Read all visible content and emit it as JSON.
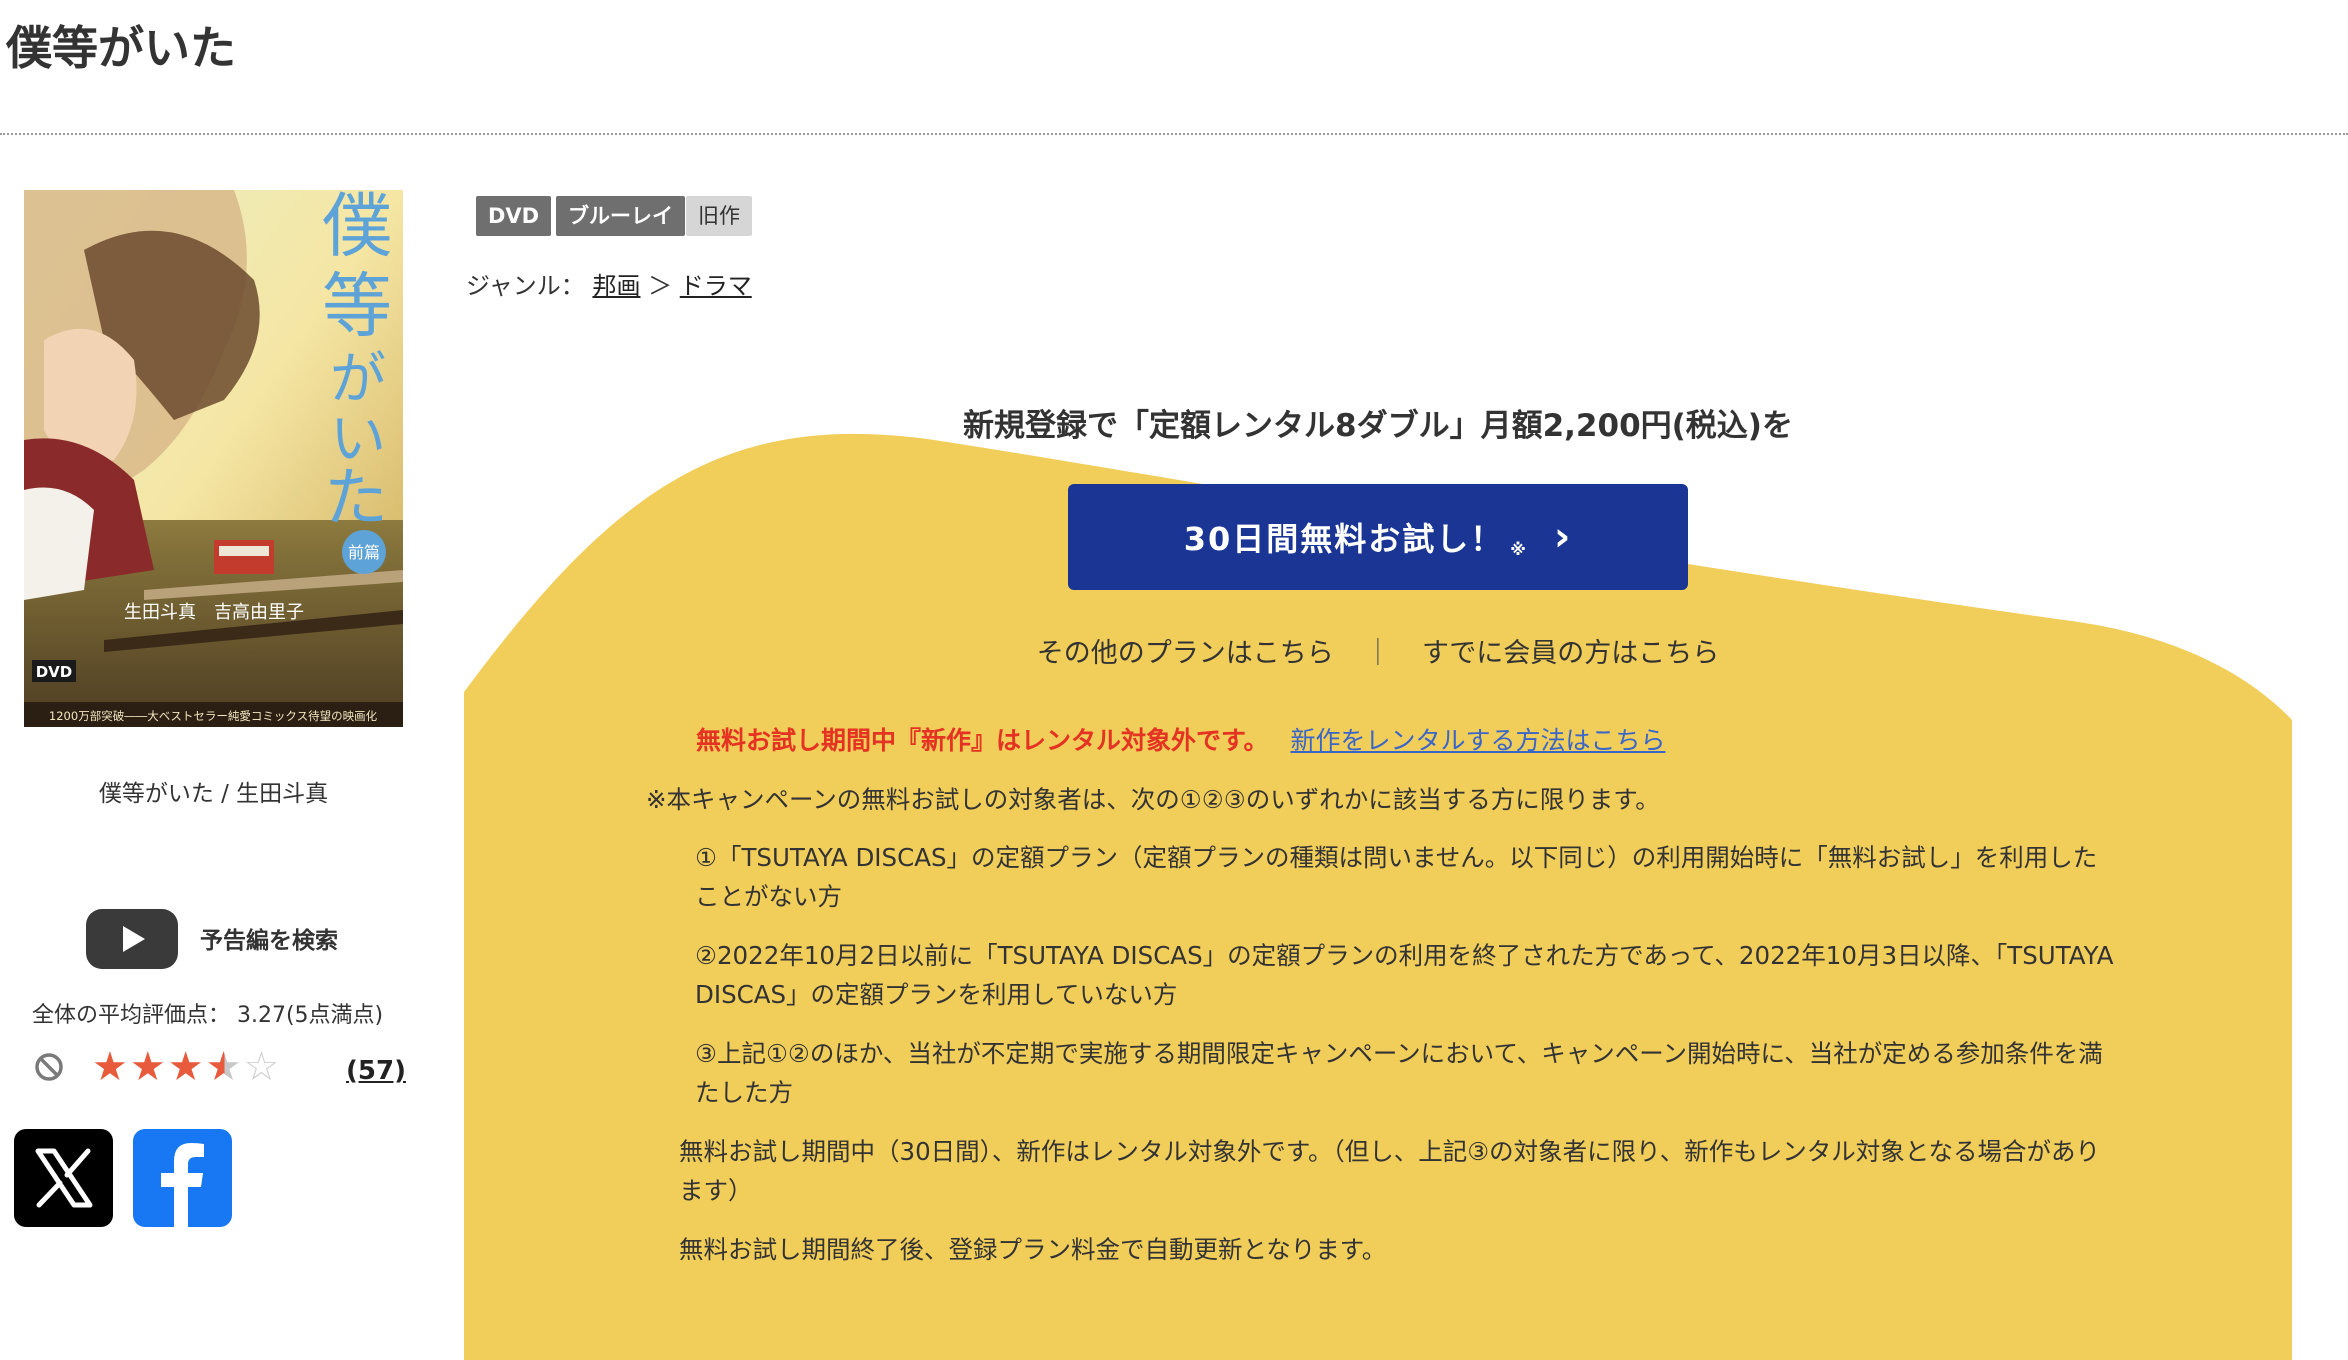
{
  "page": {
    "title": "僕等がいた"
  },
  "poster": {
    "title_vertical": "僕等がいた",
    "badge": "前篇",
    "cast": "生田斗真　吉高由里子",
    "format_logo": "DVD",
    "tagline": "1200万部突破――大ベストセラー純愛コミックス待望の映画化"
  },
  "left_column": {
    "caption": "僕等がいた / 生田斗真",
    "trailer_label": "予告編を検索",
    "average_rating": "全体の平均評価点： 3.27(5点満点)",
    "rating_value": 3.27,
    "review_count": "(57)"
  },
  "tags": [
    "DVD",
    "ブルーレイ",
    "旧作"
  ],
  "genre": {
    "label": "ジャンル：",
    "parent": "邦画",
    "sep": "＞",
    "child": "ドラマ"
  },
  "campaign": {
    "heading": "新規登録で「定額レンタル8ダブル」月額2,200円(税込)を",
    "button_label": "30日間無料お試し！",
    "button_note": "※",
    "other_plans": "その他のプランはこちら",
    "separator": "｜",
    "member_link": "すでに会員の方はこちら",
    "warning": "無料お試し期間中『新作』はレンタル対象外です。",
    "warning_link": "新作をレンタルする方法はこちら",
    "note_intro": "※本キャンペーンの無料お試しの対象者は、次の①②③のいずれかに該当する方に限ります。",
    "conditions": [
      "①「TSUTAYA DISCAS」の定額プラン（定額プランの種類は問いません。以下同じ）の利用開始時に「無料お試し」を利用したことがない方",
      "②2022年10月2日以前に「TSUTAYA DISCAS」の定額プランの利用を終了された方であって、2022年10月3日以降、「TSUTAYA DISCAS」の定額プランを利用していない方",
      "③上記①②のほか、当社が不定期で実施する期間限定キャンペーンにおいて、キャンペーン開始時に、当社が定める参加条件を満たした方"
    ],
    "trial_note": "無料お試し期間中（30日間）、新作はレンタル対象外です。（但し、上記③の対象者に限り、新作もレンタル対象となる場合があります）",
    "renew_note": "無料お試し期間終了後、登録プラン料金で自動更新となります。"
  },
  "colors": {
    "campaign_yellow": "#f1cd5a",
    "button_blue": "#1a3593",
    "warning_red": "#e53323",
    "link_blue": "#3a66c8",
    "star_red": "#e85a3c"
  },
  "icons": [
    "play-icon",
    "no-entry-icon",
    "star-icon",
    "x-logo-icon",
    "facebook-logo-icon",
    "chevron-right-icon"
  ]
}
